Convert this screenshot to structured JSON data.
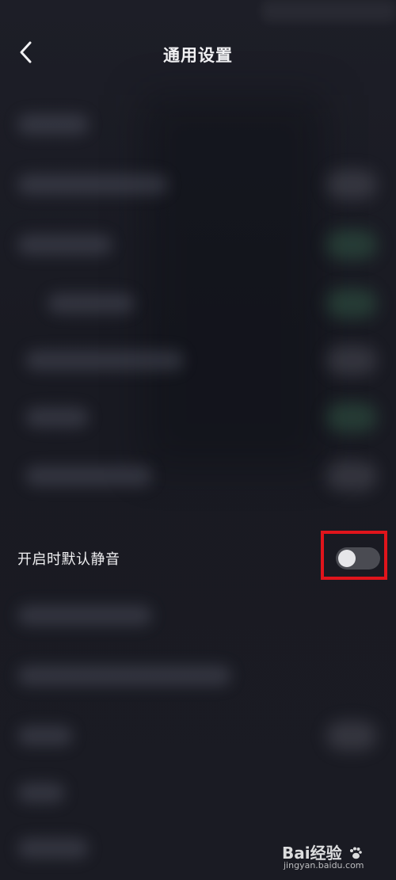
{
  "header": {
    "title": "通用设置",
    "back_icon": "chevron-left-icon"
  },
  "settings": {
    "mute_by_default": {
      "label": "开启时默认静音",
      "enabled": false
    }
  },
  "watermark": {
    "brand_text": "Bai经验",
    "domain": "jingyan.baidu.com"
  },
  "colors": {
    "background": "#1a1b23",
    "highlight": "#e0141b",
    "toggle_off": "#4a4b52"
  }
}
